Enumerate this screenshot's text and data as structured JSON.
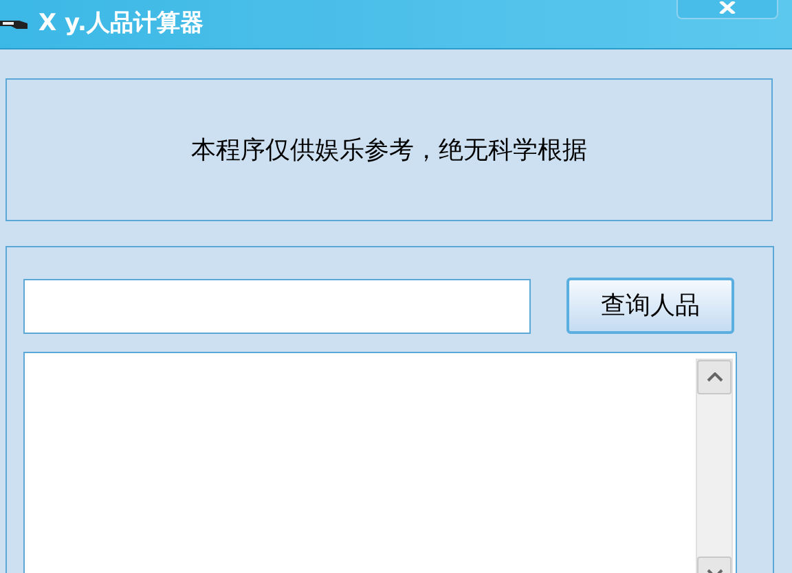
{
  "window": {
    "title": "X y.人品计算器"
  },
  "notice": {
    "text": "本程序仅供娱乐参考，绝无科学根据"
  },
  "query": {
    "button": "查询人品"
  }
}
